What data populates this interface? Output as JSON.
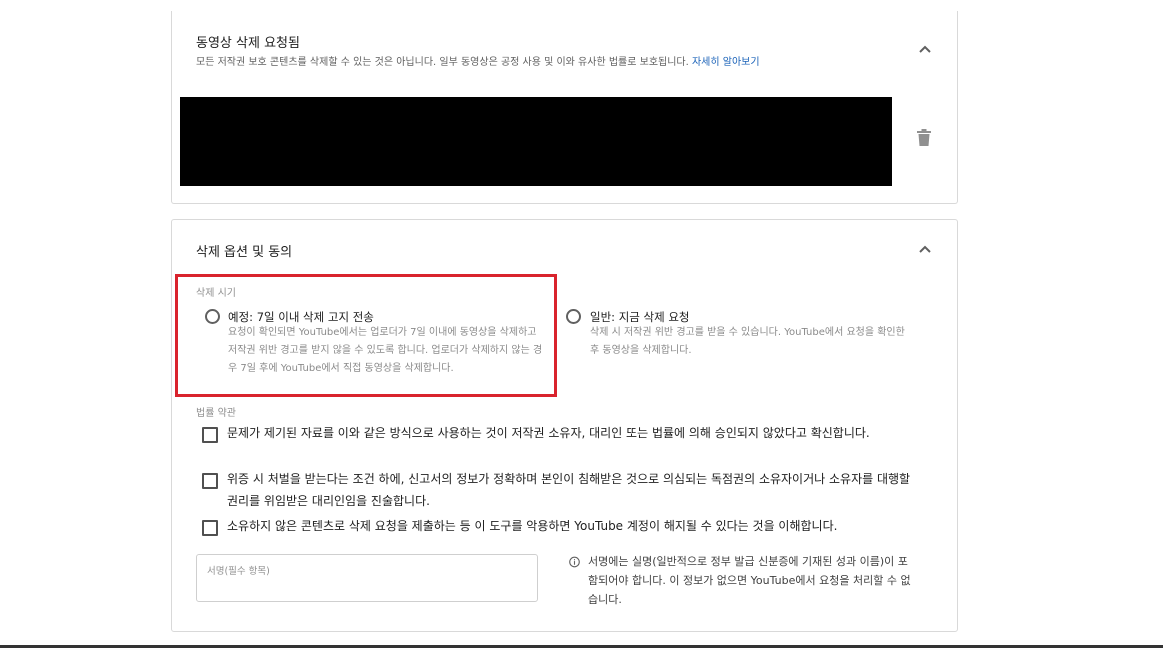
{
  "video_card": {
    "title": "동영상 삭제 요청됨",
    "subtitle": "모든 저작권 보호 콘텐츠를 삭제할 수 있는 것은 아닙니다. 일부 동영상은 공정 사용 및 이와 유사한 법률로 보호됩니다.",
    "learn_more": "자세히 알아보기",
    "collapse_icon": "chevron-up-icon",
    "delete_icon": "trash-icon"
  },
  "options_card": {
    "title": "삭제 옵션 및 동의",
    "collapse_icon": "chevron-up-icon",
    "timing": {
      "label": "삭제 시기",
      "scheduled": {
        "title": "예정: 7일 이내 삭제 고지 전송",
        "description": "요청이 확인되면 YouTube에서는 업로더가 7일 이내에 동영상을 삭제하고 저작권 위반 경고를 받지 않을 수 있도록 합니다. 업로더가 삭제하지 않는 경우 7일 후에 YouTube에서 직접 동영상을 삭제합니다."
      },
      "standard": {
        "title": "일반: 지금 삭제 요청",
        "description": "삭제 시 저작권 위반 경고를 받을 수 있습니다. YouTube에서 요청을 확인한 후 동영상을 삭제합니다."
      }
    },
    "legal": {
      "label": "법률 약관",
      "items": [
        "문제가 제기된 자료를 이와 같은 방식으로 사용하는 것이 저작권 소유자, 대리인 또는 법률에 의해 승인되지 않았다고 확신합니다.",
        "위증 시 처벌을 받는다는 조건 하에, 신고서의 정보가 정확하며 본인이 침해받은 것으로 의심되는 독점권의 소유자이거나 소유자를 대행할 권리를 위임받은 대리인임을 진술합니다.",
        "소유하지 않은 콘텐츠로 삭제 요청을 제출하는 등 이 도구를 악용하면 YouTube 계정이 해지될 수 있다는 것을 이해합니다."
      ]
    },
    "signature": {
      "placeholder": "서명(필수 항목)",
      "info_icon": "info-icon",
      "info": "서명에는 실명(일반적으로 정부 발급 신분증에 기재된 성과 이름)이 포함되어야 합니다. 이 정보가 없으면 YouTube에서 요청을 처리할 수 없습니다."
    }
  },
  "colors": {
    "highlight": "#d9232d",
    "link": "#1a62b8",
    "border": "#d9d9d9"
  }
}
